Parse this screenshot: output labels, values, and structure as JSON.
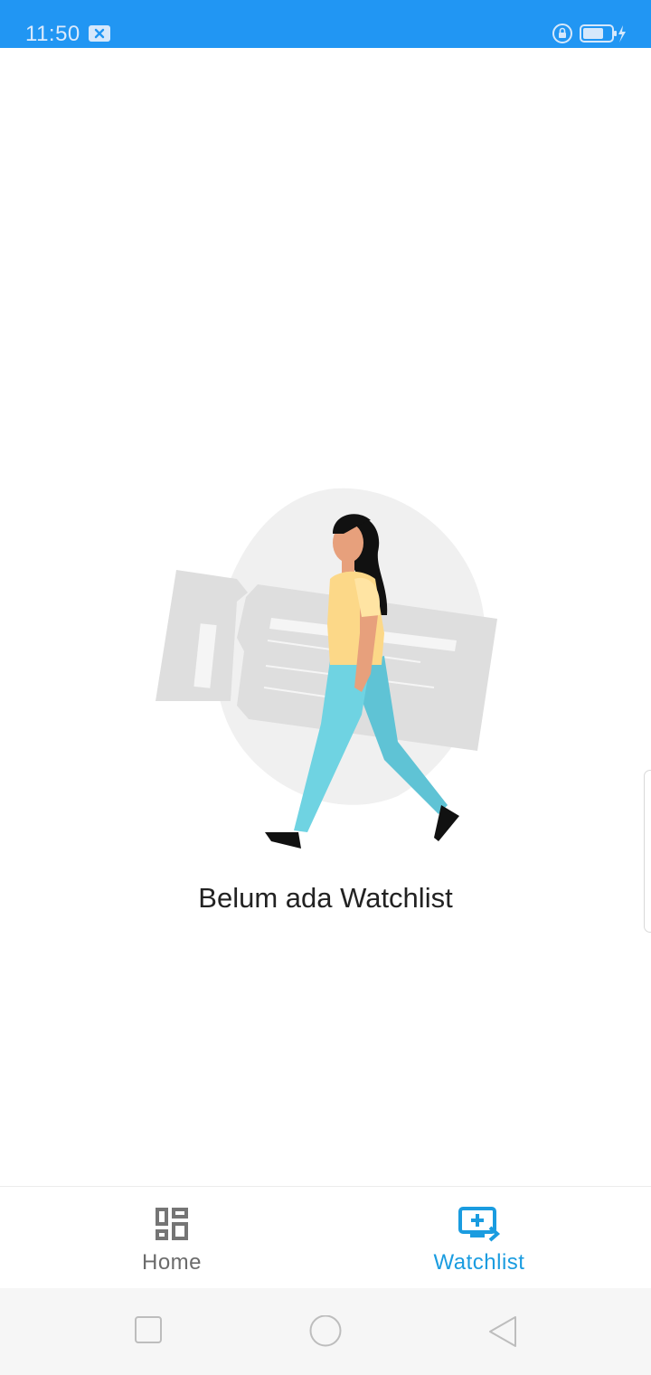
{
  "status_bar": {
    "time": "11:50",
    "background_color": "#2196f3",
    "icons": [
      "notification-close-icon",
      "rotation-lock-icon",
      "battery-charging-icon"
    ]
  },
  "empty_state": {
    "message": "Belum ada Watchlist",
    "illustration": "woman-walking-with-ticket-illustration"
  },
  "bottom_nav": {
    "items": [
      {
        "label": "Home",
        "icon": "dashboard-icon",
        "active": false
      },
      {
        "label": "Watchlist",
        "icon": "tv-add-icon",
        "active": true
      }
    ],
    "active_color": "#1a9ce0",
    "inactive_color": "#6b6b6b"
  },
  "system_nav": {
    "buttons": [
      "recent-apps-icon",
      "home-circle-icon",
      "back-triangle-icon"
    ]
  }
}
